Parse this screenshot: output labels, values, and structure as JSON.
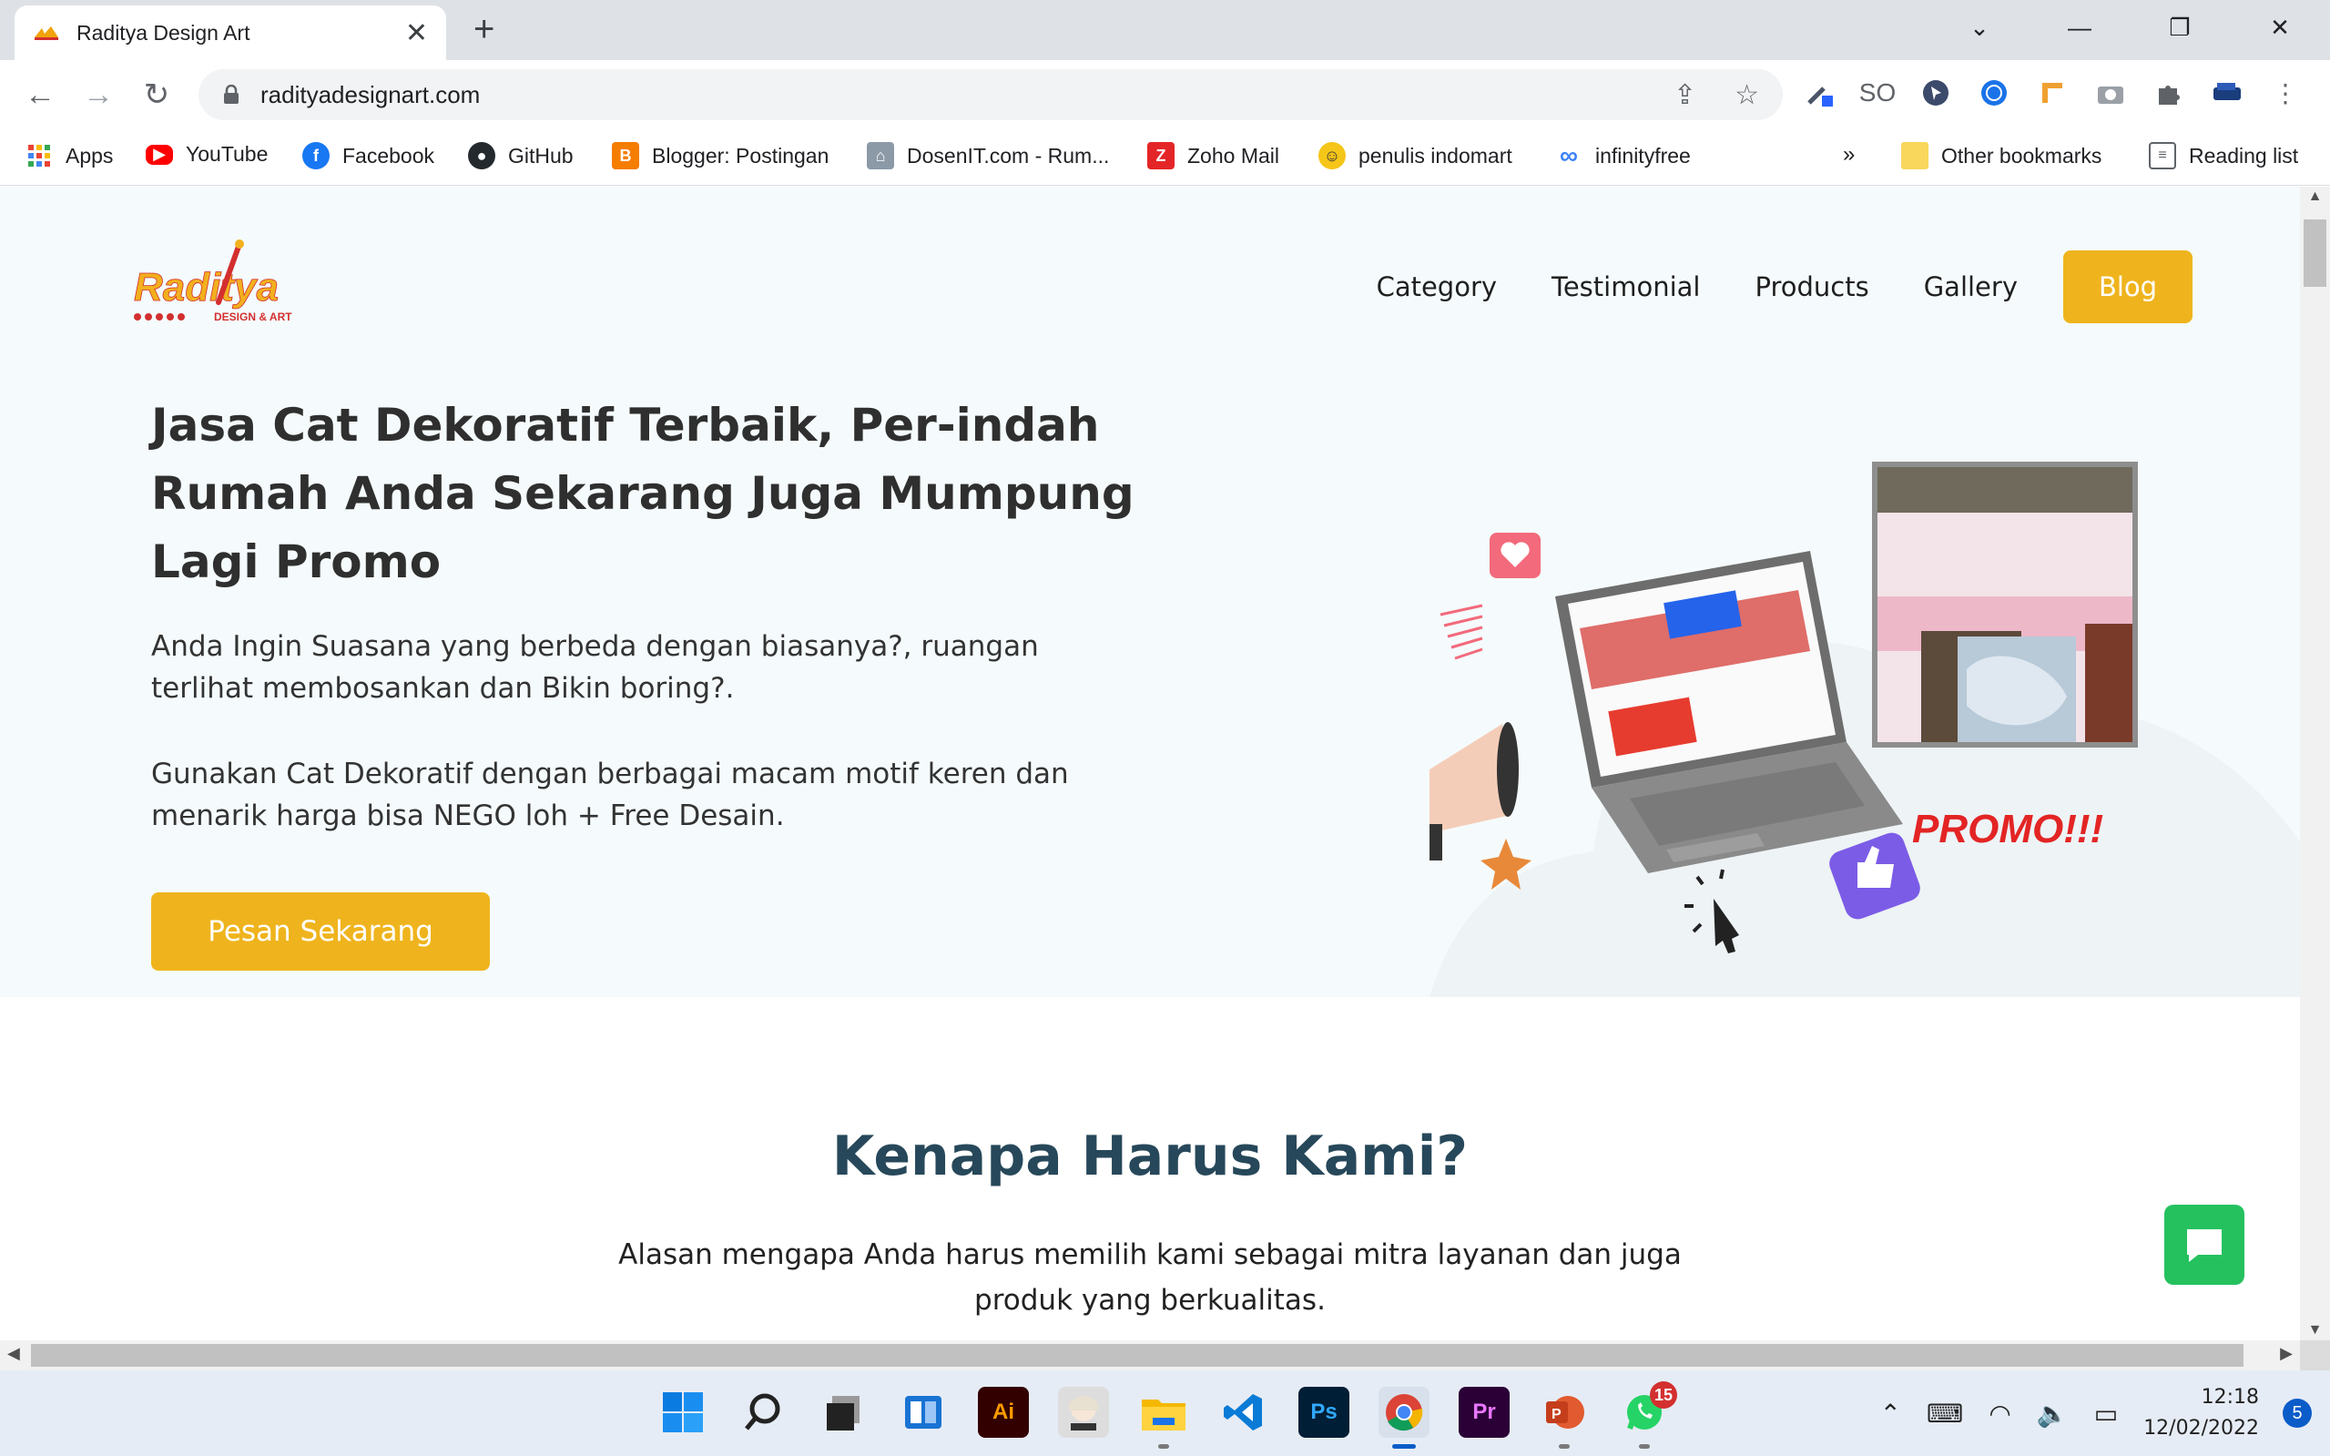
{
  "browser": {
    "tab_title": "Raditya Design Art",
    "tab_close": "✕",
    "new_tab": "+",
    "url": "radityadesignart.com",
    "window": {
      "dropdown": "⌄",
      "minimize": "—",
      "restore": "❐",
      "close": "✕"
    },
    "bookmarks": [
      {
        "label": "Apps",
        "icon": "apps-grid-icon",
        "color": "#4285f4"
      },
      {
        "label": "YouTube",
        "icon": "youtube-icon",
        "color": "#ff0000"
      },
      {
        "label": "Facebook",
        "icon": "facebook-icon",
        "color": "#1877f2"
      },
      {
        "label": "GitHub",
        "icon": "github-icon",
        "color": "#24292e"
      },
      {
        "label": "Blogger: Postingan",
        "icon": "blogger-icon",
        "color": "#f57d00"
      },
      {
        "label": "DosenIT.com - Rum...",
        "icon": "dosenit-icon",
        "color": "#8c8c8c"
      },
      {
        "label": "Zoho Mail",
        "icon": "zoho-icon",
        "color": "#e42527"
      },
      {
        "label": "penulis indomart",
        "icon": "emoji-icon",
        "color": "#f5c518"
      },
      {
        "label": "infinityfree",
        "icon": "infinity-icon",
        "color": "#3b82f6"
      }
    ],
    "bookmarks_more": "»",
    "other_bookmarks": "Other bookmarks",
    "reading_list": "Reading list"
  },
  "site": {
    "nav": [
      "Category",
      "Testimonial",
      "Products",
      "Gallery"
    ],
    "blog_button": "Blog",
    "headline": "Jasa Cat Dekoratif Terbaik, Per-indah Rumah Anda Sekarang Juga Mumpung Lagi Promo",
    "paragraph1": "Anda Ingin Suasana yang berbeda dengan biasanya?, ruangan terlihat membosankan dan Bikin boring?.",
    "paragraph2": "Gunakan Cat Dekoratif dengan berbagai macam motif keren dan menarik harga bisa NEGO loh + Free Desain.",
    "cta_button": "Pesan Sekarang",
    "promo_text": "PROMO!!!",
    "logo_text": "Raditya",
    "logo_sub": "DESIGN & ART",
    "why_title": "Kenapa Harus Kami?",
    "why_subtitle": "Alasan mengapa Anda harus memilih kami sebagai mitra layanan dan juga produk yang berkualitas."
  },
  "colors": {
    "accent": "#efb41d",
    "hero_bg": "#f5fbfc",
    "heading_dark": "#27485a",
    "chat_green": "#25c15f"
  },
  "taskbar": {
    "apps": [
      "windows-start-icon",
      "search-icon",
      "task-view-icon",
      "widgets-icon",
      "illustrator-icon",
      "anime-app-icon",
      "file-explorer-icon",
      "vscode-icon",
      "photoshop-icon",
      "chrome-icon",
      "premiere-icon",
      "powerpoint-icon",
      "whatsapp-icon"
    ],
    "whatsapp_badge": "15",
    "time": "12:18",
    "date": "12/02/2022",
    "notifications": "5"
  }
}
